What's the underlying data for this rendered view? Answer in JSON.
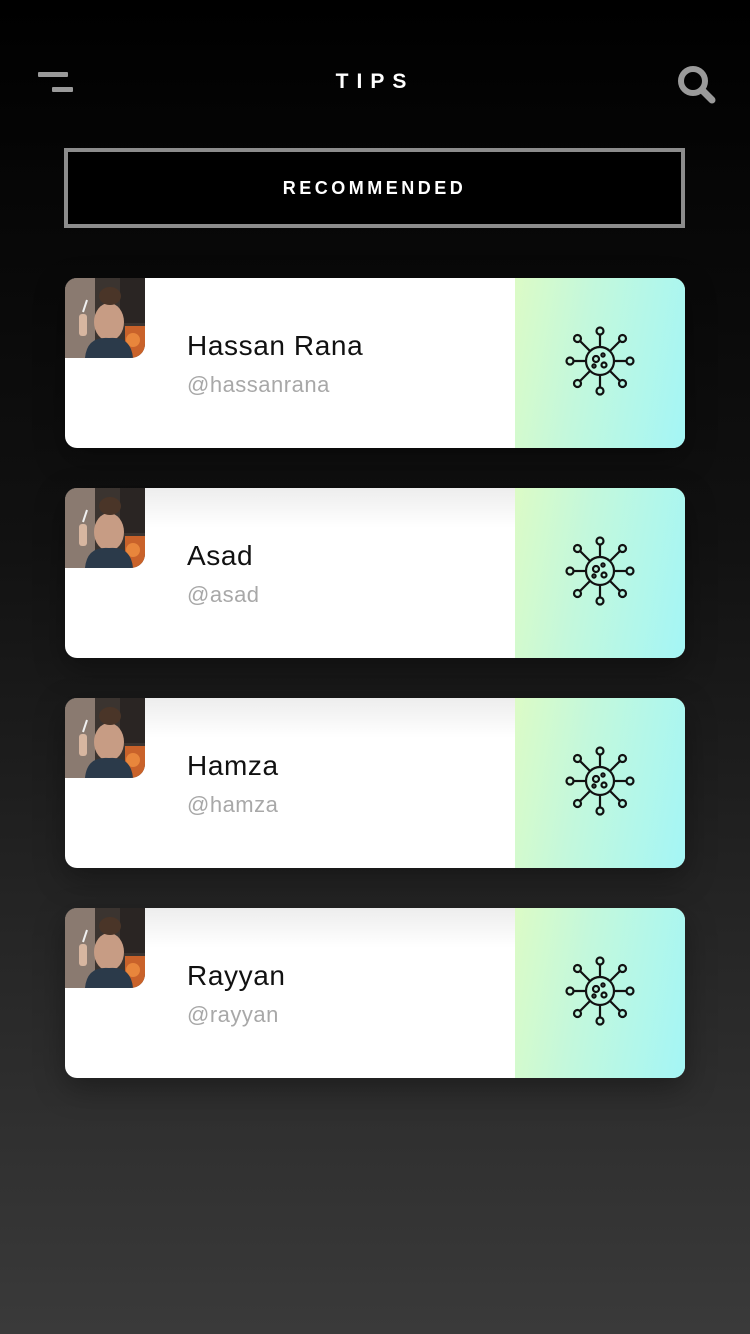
{
  "header": {
    "title": "TIPS",
    "menu_icon": "menu-icon",
    "search_icon": "search-icon"
  },
  "recommended_label": "RECOMMENDED",
  "users": [
    {
      "name": "Hassan Rana",
      "handle": "@hassanrana"
    },
    {
      "name": "Asad",
      "handle": "@asad"
    },
    {
      "name": "Hamza",
      "handle": "@hamza"
    },
    {
      "name": "Rayyan",
      "handle": "@rayyan"
    }
  ],
  "card_action_icon": "virus-icon",
  "colors": {
    "background_top": "#000000",
    "background_bottom": "#3a3a3a",
    "action_gradient_start": "#dcfbc6",
    "action_gradient_end": "#a4f6f6",
    "handle_text": "#a8a8a8"
  }
}
